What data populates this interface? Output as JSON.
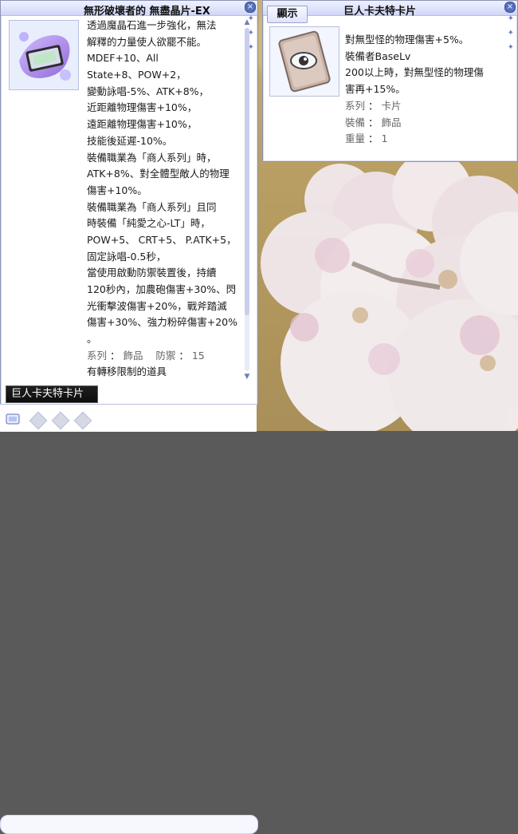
{
  "left_window": {
    "title": "無形破壞者的 無盡晶片-EX",
    "description_lines": [
      "透過魔晶石進一步強化，無法",
      "解釋的力量使人欲罷不能。",
      "MDEF+10、All",
      "State+8、POW+2，",
      "變動詠唱-5%、ATK+8%，",
      "近距離物理傷害+10%，",
      "遠距離物理傷害+10%，",
      "技能後延遲-10%。",
      "裝備職業為「商人系列」時，",
      "ATK+8%、對全體型敵人的物理",
      "傷害+10%。",
      "裝備職業為「商人系列」且同",
      "時裝備「純愛之心-LT」時，",
      "POW+5、 CRT+5、 P.ATK+5，",
      "固定詠唱-0.5秒，",
      "當使用啟動防禦裝置後，持續",
      "120秒內，加農砲傷害+30%、閃",
      "光衝擊波傷害+20%，戰斧踏滅",
      "傷害+30%、強力粉碎傷害+20%",
      "。"
    ],
    "stats": {
      "category_label": "系列",
      "category_value": "飾品",
      "defense_label": "防禦",
      "defense_value": "15"
    },
    "footer_line": "有轉移限制的道具",
    "caption": "巨人卡夫特卡片"
  },
  "right_window": {
    "show_button_label": "顯示",
    "title": "巨人卡夫特卡片",
    "description_lines": [
      "對無型怪的物理傷害+5%。",
      "裝備者BaseLv",
      "200以上時，對無型怪的物理傷",
      "害再+15%。"
    ],
    "stats": [
      {
        "label": "系列",
        "value": "卡片"
      },
      {
        "label": "裝備",
        "value": "飾品"
      },
      {
        "label": "重量",
        "value": "1"
      }
    ]
  },
  "icons": {
    "close": "close-icon",
    "item": "crystal-chip-icon",
    "card": "eye-card-icon",
    "scroll_up": "chevron-up-icon",
    "scroll_down": "chevron-down-icon"
  },
  "colors": {
    "accent": "#556fbe",
    "window_border": "#8a93b3",
    "title_bg": "#dfe4fb"
  }
}
